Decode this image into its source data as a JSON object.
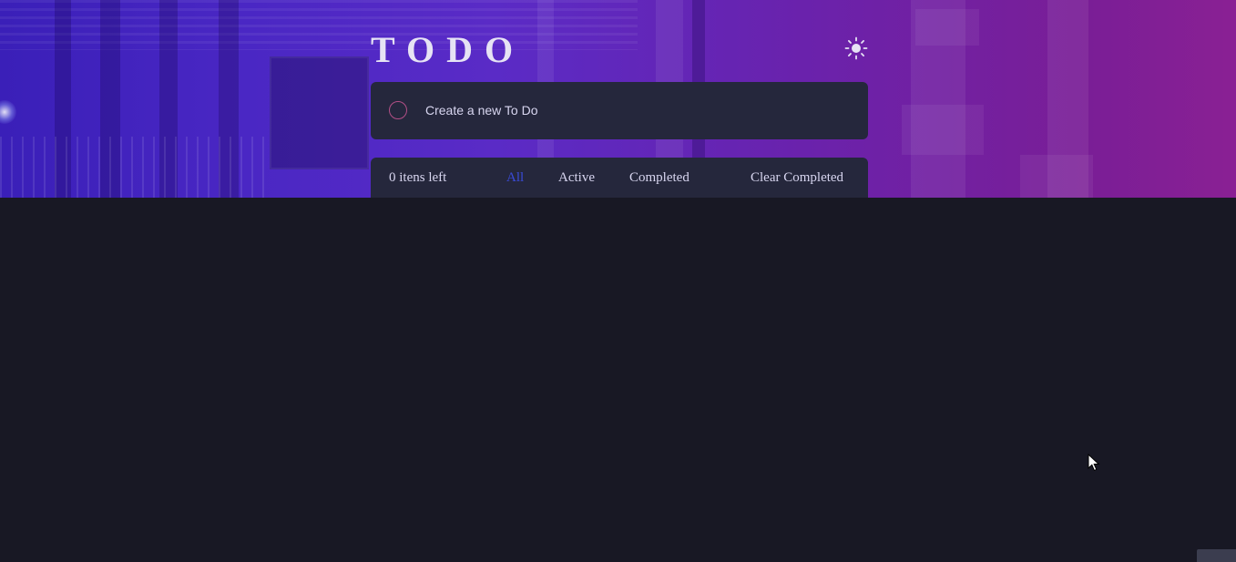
{
  "app": {
    "title": "TODO",
    "theme_icon": "sun-icon"
  },
  "new_todo": {
    "placeholder": "Create a new To Do",
    "value": ""
  },
  "footer": {
    "items_left": "0 itens left",
    "filters": [
      {
        "label": "All",
        "selected": true
      },
      {
        "label": "Active",
        "selected": false
      },
      {
        "label": "Completed",
        "selected": false
      }
    ],
    "clear_completed": "Clear Completed"
  },
  "colors": {
    "background": "#181824",
    "card": "#25273c",
    "accent": "#3a4bd8",
    "check_circle": "#b24f86",
    "text": "#d8d6f0"
  }
}
